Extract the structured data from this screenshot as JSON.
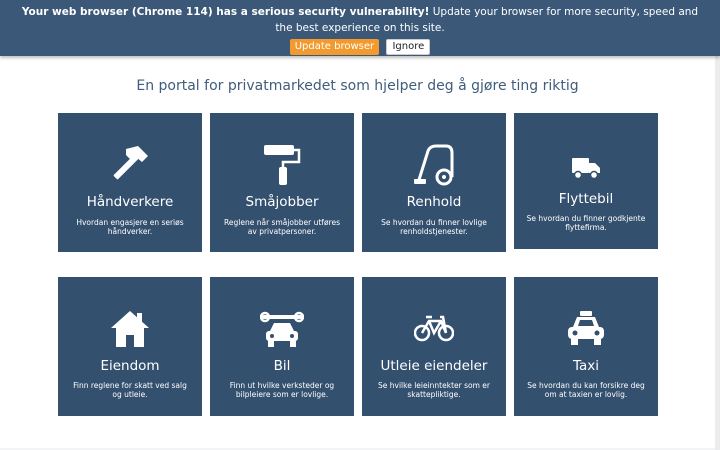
{
  "banner": {
    "bold": "Your web browser (Chrome 114) has a serious security vulnerability!",
    "rest": " Update your browser for more security, speed and the best experience on this site.",
    "update_label": "Update browser",
    "ignore_label": "Ignore",
    "accent": "#f29a2e",
    "background": "#3b5878"
  },
  "main": {
    "heading": "En portal for privatmarkedet som hjelper deg å gjøre ting riktig",
    "card_color": "#34506f",
    "cards": [
      {
        "title": "Håndverkere",
        "desc": "Hvordan engasjere en seriøs håndverker.",
        "icon": "hammer-icon"
      },
      {
        "title": "Småjobber",
        "desc": "Reglene når småjobber utføres av privatpersoner.",
        "icon": "paint-roller-icon"
      },
      {
        "title": "Renhold",
        "desc": "Se hvordan du finner lovlige renholdstjenester.",
        "icon": "vacuum-cleaner-icon"
      },
      {
        "title": "Flyttebil",
        "desc": "Se hvordan du finner godkjente flyttefirma.",
        "icon": "truck-icon"
      },
      {
        "title": "Eiendom",
        "desc": "Finn reglene for skatt ved salg og utleie.",
        "icon": "house-icon"
      },
      {
        "title": "Bil",
        "desc": "Finn ut hvilke verksteder og bilpleiere som er lovlige.",
        "icon": "car-wrench-icon"
      },
      {
        "title": "Utleie eiendeler",
        "desc": "Se hvilke leieinntekter som er skattepliktige.",
        "icon": "bicycle-icon"
      },
      {
        "title": "Taxi",
        "desc": "Se hvordan du kan forsikre deg om at taxien er lovlig.",
        "icon": "taxi-icon"
      }
    ]
  }
}
